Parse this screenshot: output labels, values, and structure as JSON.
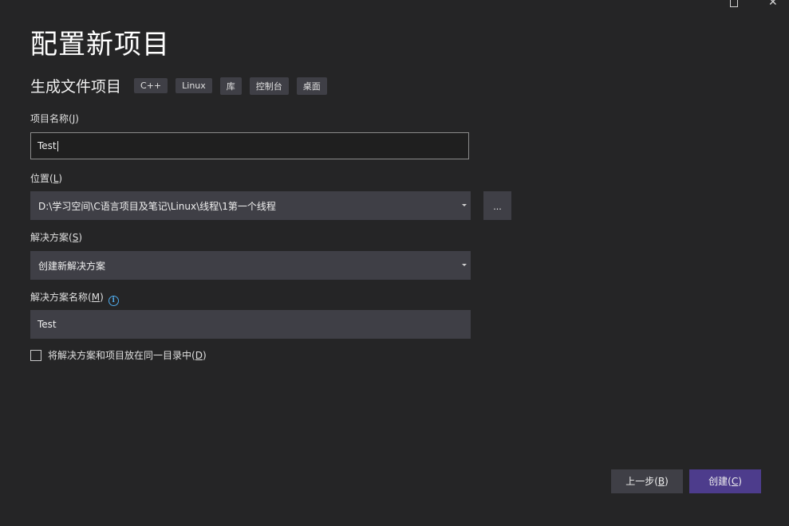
{
  "window": {
    "maximize_glyph": "",
    "close_glyph": "✕"
  },
  "page_title": "配置新项目",
  "subtitle": "生成文件项目",
  "tags": [
    "C++",
    "Linux",
    "库",
    "控制台",
    "桌面"
  ],
  "project_name": {
    "label": "项目名称",
    "mnemonic": "J",
    "value": "Test"
  },
  "location": {
    "label": "位置",
    "mnemonic": "L",
    "value": "D:\\学习空间\\C语言项目及笔记\\Linux\\线程\\1第一个线程",
    "browse_label": "..."
  },
  "solution": {
    "label": "解决方案",
    "mnemonic": "S",
    "value": "创建新解决方案"
  },
  "solution_name": {
    "label": "解决方案名称",
    "mnemonic": "M",
    "value": "Test",
    "info_icon": "info-icon"
  },
  "same_dir": {
    "label": "将解决方案和项目放在同一目录中",
    "mnemonic": "D",
    "checked": false
  },
  "buttons": {
    "back_label": "上一步",
    "back_mnemonic": "B",
    "create_label": "创建",
    "create_mnemonic": "C"
  },
  "colors": {
    "background": "#252526",
    "control": "#3f3f46",
    "primary_button": "#4d3c8c",
    "info_accent": "#4fa9e8"
  }
}
